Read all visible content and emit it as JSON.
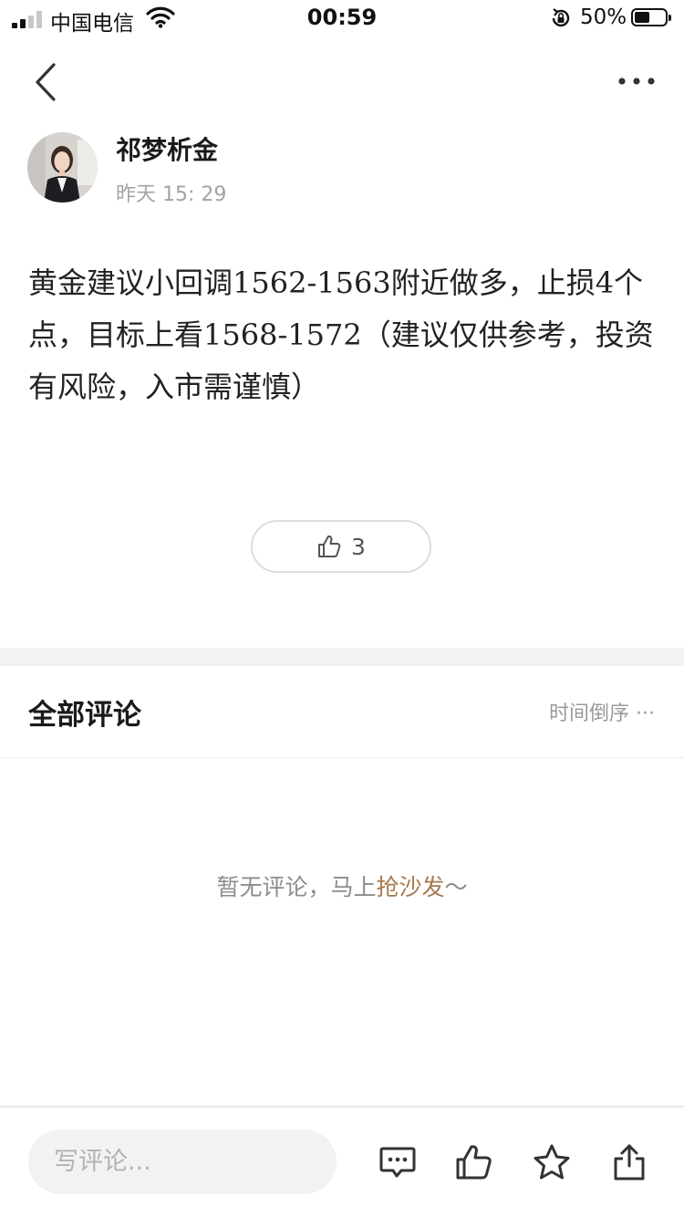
{
  "status_bar": {
    "carrier": "中国电信",
    "time": "00:59",
    "battery_percent": "50%",
    "battery_level": 0.5,
    "icons": [
      "signal-icon",
      "wifi-icon",
      "orientation-lock-icon",
      "battery-icon"
    ]
  },
  "nav": {
    "back_icon": "chevron-left-icon",
    "more_icon": "more-dots-icon"
  },
  "post": {
    "author": "祁梦析金",
    "time": "昨天 15: 29",
    "content": "黄金建议小回调1562-1563附近做多，止损4个点，目标上看1568-1572（建议仅供参考，投资有风险，入市需谨慎）",
    "like_count": "3",
    "like_icon": "thumbs-up-icon"
  },
  "comments": {
    "title": "全部评论",
    "sort_label": "时间倒序 ···",
    "empty_prefix": "暂无评论，马上",
    "empty_link": "抢沙发",
    "empty_suffix": "～"
  },
  "bottom_bar": {
    "input_placeholder": "写评论...",
    "icons": [
      "comment-icon",
      "like-icon",
      "favorite-star-icon",
      "share-icon"
    ]
  },
  "colors": {
    "accent_link": "#a8794f",
    "section_gap": "#f2f2f2",
    "muted_text": "#999999"
  }
}
